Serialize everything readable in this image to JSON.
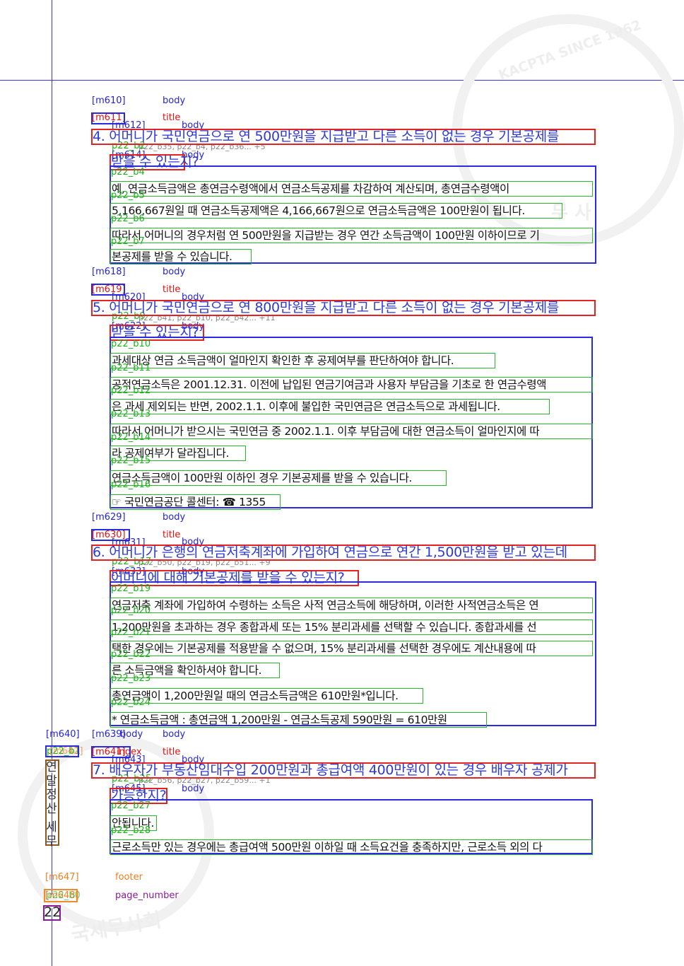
{
  "layout_labels": {
    "body": "body",
    "title": "title",
    "footer": "footer",
    "page_number": "page_number",
    "index": "index"
  },
  "watermarks": {
    "top_right": "KACPTA SINCE 1962",
    "mid_right": "무 사",
    "bottom_left": "국세무사회"
  },
  "sections": [
    {
      "container_id": "[m610]",
      "title_id": "[m611]",
      "title_region_id": "[m612]",
      "title_overlap": "p22_b2",
      "line_ids": "p22_b35, p22_b4, p22_b36... +5",
      "body_region_id": "[m614]",
      "title_lines": [
        "4. 어머니가 국민연금으로 연 500만원을 지급받고 다른 소득이 없는 경우 기본공제를",
        "받을 수 있는지?"
      ],
      "paragraphs": [
        {
          "id": "p22_b4",
          "text": "예, 연금소득금액은 총연금수령액에서 연금소득공제를 차감하여 계산되며, 총연금수령액이"
        },
        {
          "id": "p22_b5",
          "text": "5,166,667원일 때 연금소득공제액은 4,166,667원으로 연금소득금액은 100만원이 됩니다."
        },
        {
          "id": "p22_b6",
          "text": "따라서 어머니의 경우처럼 연 500만원을 지급받는 경우 연간 소득금액이 100만원 이하이므로 기"
        },
        {
          "id": "p22_b7",
          "text": "본공제를 받을 수 있습니다."
        }
      ]
    },
    {
      "container_id": "[m618]",
      "title_id": "[m619]",
      "title_region_id": "[m620]",
      "title_overlap": "p22_b9",
      "line_ids": "p22_b41, p22_b10, p22_b42... +11",
      "body_region_id": "[m622]",
      "title_lines": [
        "5. 어머니가 국민연금으로 연 800만원을 지급받고 다른 소득이 없는 경우 기본공제를",
        "받을 수 있는지?"
      ],
      "paragraphs": [
        {
          "id": "p22_b10",
          "text": "과세대상 연금 소득금액이 얼마인지 확인한 후 공제여부를 판단하여야 합니다."
        },
        {
          "id": "p22_b11",
          "text": "공적연금소득은 2001.12.31. 이전에 납입된 연금기여금과 사용자 부담금을 기초로 한 연금수령액"
        },
        {
          "id": "p22_b12",
          "text": "은 과세 제외되는 반면, 2002.1.1. 이후에 불입한 국민연금은 연금소득으로 과세됩니다."
        },
        {
          "id": "p22_b13",
          "text": "따라서 어머니가 받으시는 국민연금 중 2002.1.1. 이후 부담금에 대한 연금소득이 얼마인지에 따"
        },
        {
          "id": "p22_b14",
          "text": "라 공제여부가 달라집니다."
        },
        {
          "id": "p22_b15",
          "text": "연금소득금액이 100만원 이하인 경우 기본공제를 받을 수 있습니다."
        },
        {
          "id": "p22_b16",
          "text": "☞ 국민연금공단 콜센터: ☎ 1355"
        }
      ]
    },
    {
      "container_id": "[m629]",
      "title_id": "[m630]",
      "title_region_id": "[m631]",
      "title_overlap": "p22_b17",
      "line_ids": "p22_b50, p22_b19, p22_b51... +9",
      "body_region_id": "[m633]",
      "title_lines": [
        "6. 어머니가 은행의 연금저축계좌에 가입하여 연금으로 연간 1,500만원을 받고 있는데",
        "어머니에 대해 기본공제를 받을 수 있는지?"
      ],
      "paragraphs": [
        {
          "id": "p22_b19",
          "text": "연금저축 계좌에 가입하여 수령하는 소득은 사적 연금소득에 해당하며, 이러한 사적연금소득은 연"
        },
        {
          "id": "p22_b20",
          "text": "1,200만원을 초과하는 경우 종합과세 또는 15% 분리과세를 선택할 수 있습니다. 종합과세를 선"
        },
        {
          "id": "p22_b21",
          "text": "택한 경우에는 기본공제를 적용받을 수 없으며, 15% 분리과세를 선택한 경우에도 계산내용에 따"
        },
        {
          "id": "p22_b22",
          "text": "른 소득금액을 확인하셔야 합니다."
        },
        {
          "id": "p22_b23",
          "text": "총연금액이 1,200만원일 때의 연금소득금액은 610만원*입니다."
        },
        {
          "id": "p22_b24",
          "text": "* 연금소득금액 : 총연금액 1,200만원 - 연금소득공제 590만원 = 610만원"
        }
      ]
    },
    {
      "container_id": "[m639]",
      "title_id": "[m641]",
      "title_region_id": "[m643]",
      "title_overlap": "p22_b25",
      "line_ids": "p22_b56, p22_b27, p22_b59... +1",
      "body_region_id": "[m645]",
      "title_lines": [
        "7. 배우자가 부동산임대수입 200만원과 총급여액 400만원이 있는 경우 배우자 공제가",
        "가능한지?"
      ],
      "paragraphs": [
        {
          "id": "p22_b27",
          "text": "안됩니다."
        },
        {
          "id": "p22_b28",
          "text": "근로소득만 있는 경우에는 총급여액 500만원 이하일 때 소득요건을 충족하지만, 근로소득 외의 다"
        }
      ]
    }
  ],
  "sidebar": {
    "container_id": "[m640]",
    "index_id": "[m642]",
    "overlap_id": "p22_b1",
    "text": "연말정산 세무",
    "chars": [
      "연",
      "말",
      "정",
      "산",
      "",
      "세",
      "무"
    ]
  },
  "footer": {
    "id": "[m647]",
    "page_number_id": "[m648]",
    "overlap_id": "p22_b0",
    "page_number": "22"
  }
}
